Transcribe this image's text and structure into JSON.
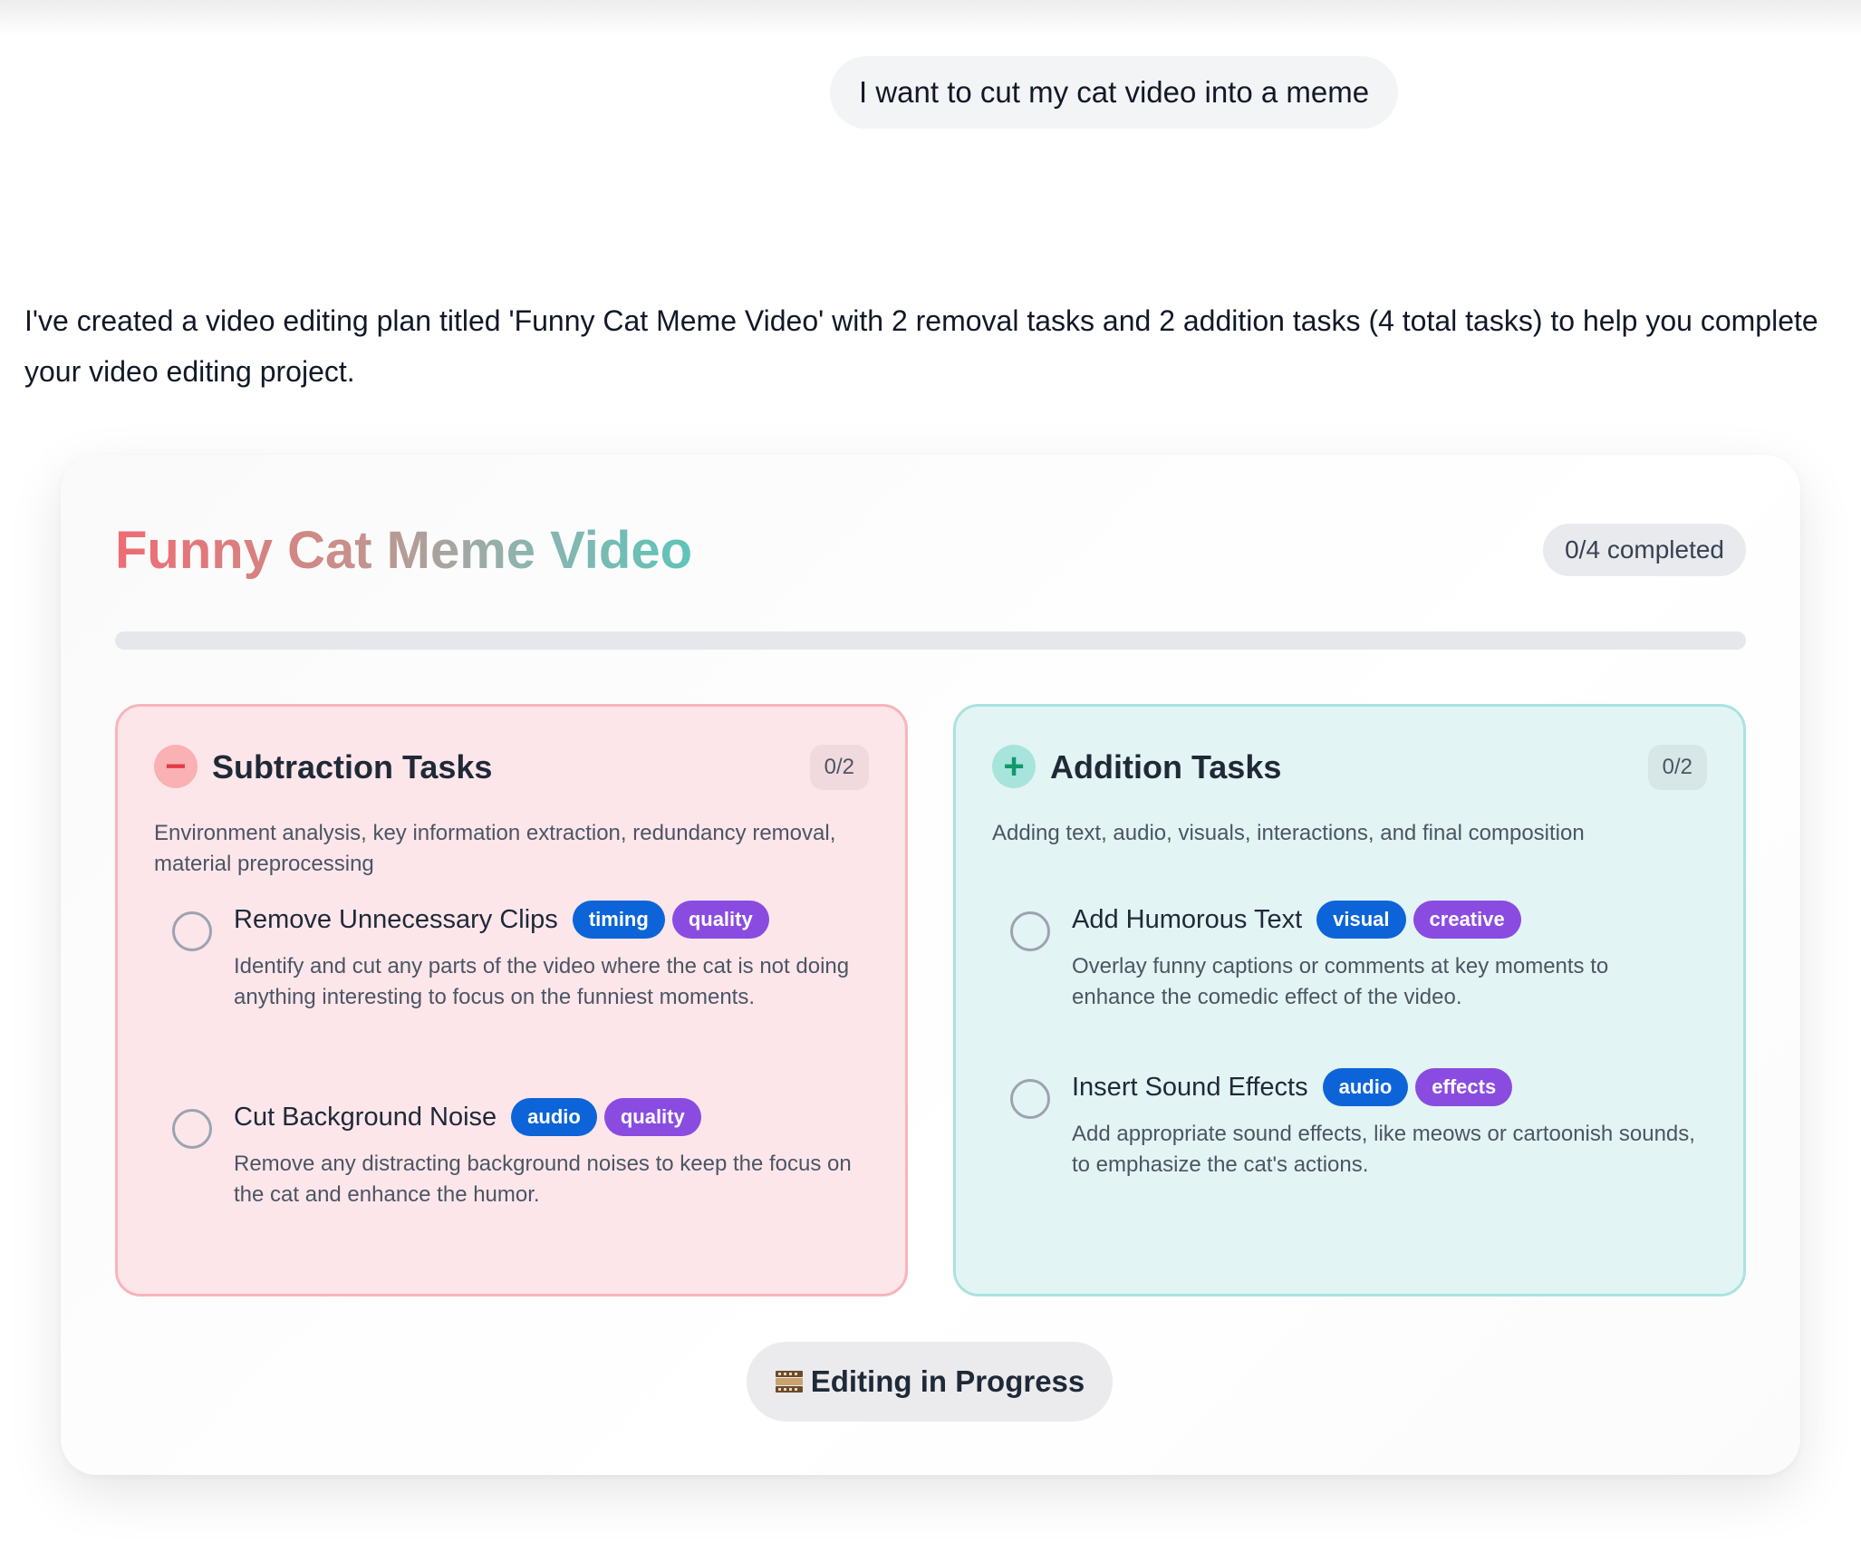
{
  "chat": {
    "user_message": "I want to cut my cat video into a meme",
    "assistant_message": "I've created a video editing plan titled 'Funny Cat Meme Video' with 2 removal tasks and 2 addition tasks (4 total tasks) to help you complete your video editing project."
  },
  "plan": {
    "title": "Funny Cat Meme Video",
    "completed_label": "0/4 completed",
    "progress_fraction": 0,
    "status_label": "Editing in Progress",
    "status_icon": "film-frames-icon"
  },
  "subtraction": {
    "icon": "minus-icon",
    "title": "Subtraction Tasks",
    "count": "0/2",
    "description": "Environment analysis, key information extraction, redundancy removal, material preprocessing",
    "tasks": [
      {
        "title": "Remove Unnecessary Clips",
        "tags": [
          "timing",
          "quality"
        ],
        "description": "Identify and cut any parts of the video where the cat is not doing anything interesting to focus on the funniest moments."
      },
      {
        "title": "Cut Background Noise",
        "tags": [
          "audio",
          "quality"
        ],
        "description": "Remove any distracting background noises to keep the focus on the cat and enhance the humor."
      }
    ]
  },
  "addition": {
    "icon": "plus-icon",
    "title": "Addition Tasks",
    "count": "0/2",
    "description": "Adding text, audio, visuals, interactions, and final composition",
    "tasks": [
      {
        "title": "Add Humorous Text",
        "tags": [
          "visual",
          "creative"
        ],
        "description": "Overlay funny captions or comments at key moments to enhance the comedic effect of the video."
      },
      {
        "title": "Insert Sound Effects",
        "tags": [
          "audio",
          "effects"
        ],
        "description": "Add appropriate sound effects, like meows or cartoonish sounds, to emphasize the cat's actions."
      }
    ]
  },
  "colors": {
    "tag_blue": "#0c64d8",
    "tag_purple": "#8a4ce0",
    "subtraction_bg": "#fde6ea",
    "addition_bg": "#e3f4f4",
    "minus_icon": "#e23b43",
    "plus_icon": "#10996b"
  }
}
